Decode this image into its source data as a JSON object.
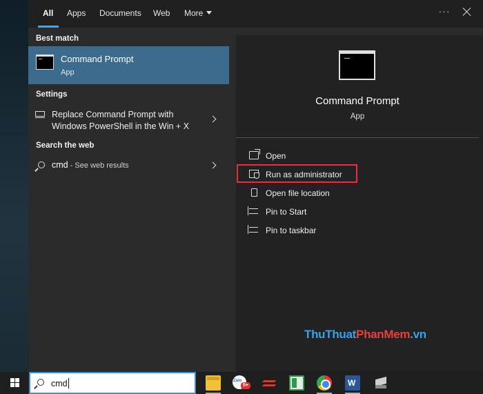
{
  "tabs": [
    {
      "label": "All",
      "active": true
    },
    {
      "label": "Apps"
    },
    {
      "label": "Documents"
    },
    {
      "label": "Web"
    },
    {
      "label": "More"
    }
  ],
  "toolbar": {
    "more_options_icon": "ellipsis-icon",
    "close_icon": "close-icon"
  },
  "results": {
    "best_match_header": "Best match",
    "best_match": {
      "title": "Command Prompt",
      "subtitle": "App",
      "icon": "terminal-icon"
    },
    "settings_header": "Settings",
    "settings_item": {
      "line1": "Replace Command Prompt with",
      "line2": "Windows PowerShell in the Win + X",
      "icon": "monitor-icon"
    },
    "web_header": "Search the web",
    "web_item": {
      "query": "cmd",
      "suffix": " - See web results",
      "icon": "search-icon"
    }
  },
  "details": {
    "title": "Command Prompt",
    "subtitle": "App",
    "actions": [
      {
        "label": "Open",
        "icon": "open-icon"
      },
      {
        "label": "Run as administrator",
        "icon": "shield-icon",
        "highlighted": true
      },
      {
        "label": "Open file location",
        "icon": "folder-icon"
      },
      {
        "label": "Pin to Start",
        "icon": "pin-icon"
      },
      {
        "label": "Pin to taskbar",
        "icon": "pin-icon"
      }
    ]
  },
  "watermark": {
    "part1": "ThuThuat",
    "part2": "PhanMem",
    "part3": ".vn"
  },
  "taskbar": {
    "search_value": "cmd",
    "zalo_badge": "5+",
    "apps": [
      "file-explorer-icon",
      "zalo-icon",
      "anydesk-icon",
      "maps-icon",
      "chrome-icon",
      "word-icon",
      "app-icon"
    ]
  },
  "colors": {
    "accent": "#3d6b8d",
    "highlight_box": "#e2323a",
    "search_border": "#3d8fd6"
  }
}
